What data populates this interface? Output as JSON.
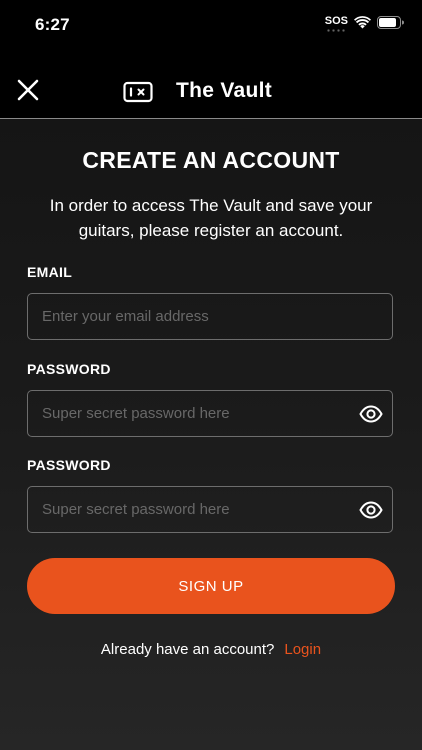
{
  "status_bar": {
    "time": "6:27",
    "sos": "SOS"
  },
  "nav": {
    "title": "The Vault"
  },
  "form": {
    "heading": "CREATE AN ACCOUNT",
    "description": "In order to access The Vault and save your guitars, please register an account.",
    "email": {
      "label": "EMAIL",
      "placeholder": "Enter your email address"
    },
    "password": {
      "label": "PASSWORD",
      "placeholder": "Super secret password here"
    },
    "confirm_password": {
      "label": "PASSWORD",
      "placeholder": "Super secret password here"
    },
    "submit_label": "SIGN UP"
  },
  "footer": {
    "prompt": "Already have an account?",
    "login_label": "Login"
  },
  "colors": {
    "accent": "#e9531d",
    "background": "#000000",
    "field_border": "#6d6d6d"
  },
  "icons": [
    "close-icon",
    "vault-icon",
    "eye-icon",
    "wifi-icon",
    "battery-icon"
  ]
}
